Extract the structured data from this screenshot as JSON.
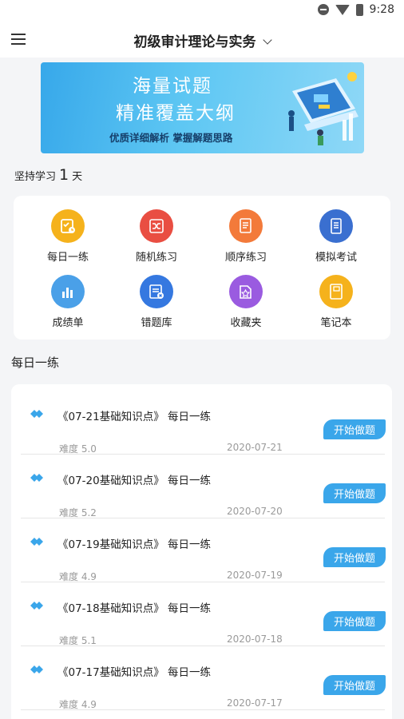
{
  "status_bar": {
    "time": "9:28"
  },
  "header": {
    "title": "初级审计理论与实务"
  },
  "banner": {
    "line1": "海量试题",
    "line2": "精准覆盖大纲",
    "line3": "优质详细解析 掌握解题思路"
  },
  "streak": {
    "prefix": "坚持学习",
    "days": "1",
    "suffix": "天"
  },
  "grid": [
    {
      "label": "每日一练",
      "icon": "calendar-check-icon",
      "color": "#f5b21c"
    },
    {
      "label": "随机练习",
      "icon": "shuffle-icon",
      "color": "#e94e42"
    },
    {
      "label": "顺序练习",
      "icon": "document-list-icon",
      "color": "#f37a3a"
    },
    {
      "label": "模拟考试",
      "icon": "exam-book-icon",
      "color": "#3a6fd0"
    },
    {
      "label": "成绩单",
      "icon": "bar-chart-icon",
      "color": "#4aa0e8"
    },
    {
      "label": "错题库",
      "icon": "wrong-questions-icon",
      "color": "#3578e0"
    },
    {
      "label": "收藏夹",
      "icon": "star-folder-icon",
      "color": "#9a5be0"
    },
    {
      "label": "笔记本",
      "icon": "notebook-icon",
      "color": "#f5b21c"
    }
  ],
  "section": {
    "title": "每日一练"
  },
  "items": [
    {
      "title": "《07-21基础知识点》 每日一练",
      "difficulty": "难度 5.0",
      "date": "2020-07-21",
      "button": "开始做题"
    },
    {
      "title": "《07-20基础知识点》 每日一练",
      "difficulty": "难度 5.2",
      "date": "2020-07-20",
      "button": "开始做题"
    },
    {
      "title": "《07-19基础知识点》 每日一练",
      "difficulty": "难度 4.9",
      "date": "2020-07-19",
      "button": "开始做题"
    },
    {
      "title": "《07-18基础知识点》 每日一练",
      "difficulty": "难度 5.1",
      "date": "2020-07-18",
      "button": "开始做题"
    },
    {
      "title": "《07-17基础知识点》 每日一练",
      "difficulty": "难度 4.9",
      "date": "2020-07-17",
      "button": "开始做题"
    }
  ]
}
